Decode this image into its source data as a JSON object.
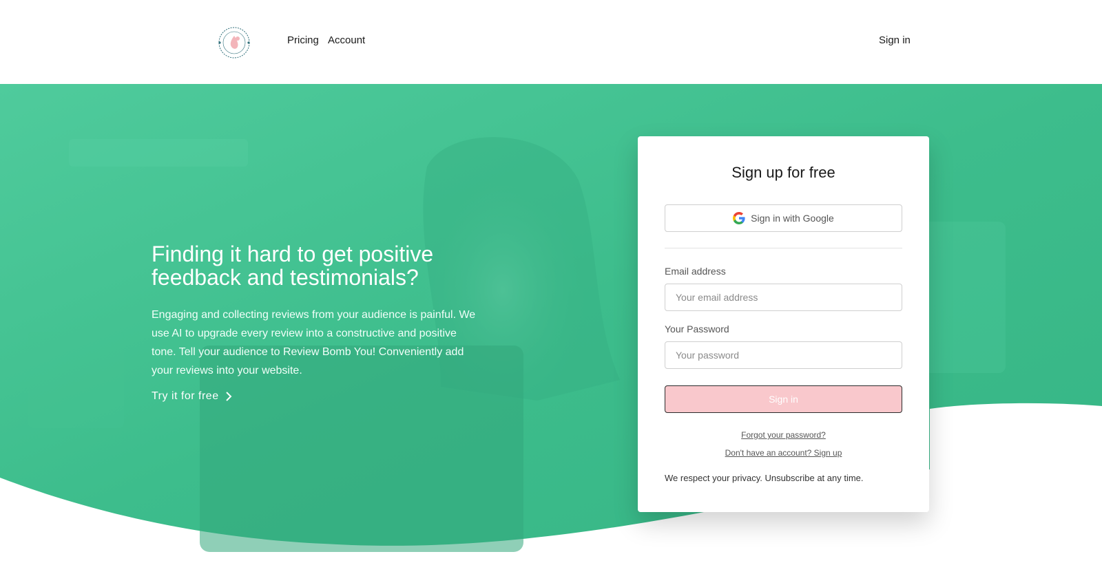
{
  "header": {
    "logo_alt": "Review Bomb You",
    "nav": [
      {
        "label": "Pricing"
      },
      {
        "label": "Account"
      }
    ],
    "signin_label": "Sign in"
  },
  "hero": {
    "title": "Finding it hard to get positive feedback and testimonials?",
    "description": "Engaging and collecting reviews from your audience is painful. We use AI to upgrade every review into a constructive and positive tone. Tell your audience to Review Bomb You! Conveniently add your reviews into your website.",
    "cta_label": "Try it for free"
  },
  "signup": {
    "title": "Sign up for free",
    "google_label": "Sign in with Google",
    "email_label": "Email address",
    "email_placeholder": "Your email address",
    "email_value": "",
    "password_label": "Your Password",
    "password_placeholder": "Your password",
    "password_value": "",
    "submit_label": "Sign in",
    "forgot_link": "Forgot your password?",
    "signup_link": "Don't have an account? Sign up",
    "privacy_note": "We respect your privacy. Unsubscribe at any time."
  },
  "colors": {
    "brand_green": "#3fbf8f",
    "button_pink": "#f9c8cc",
    "logo_pink": "#f3b5ba"
  }
}
